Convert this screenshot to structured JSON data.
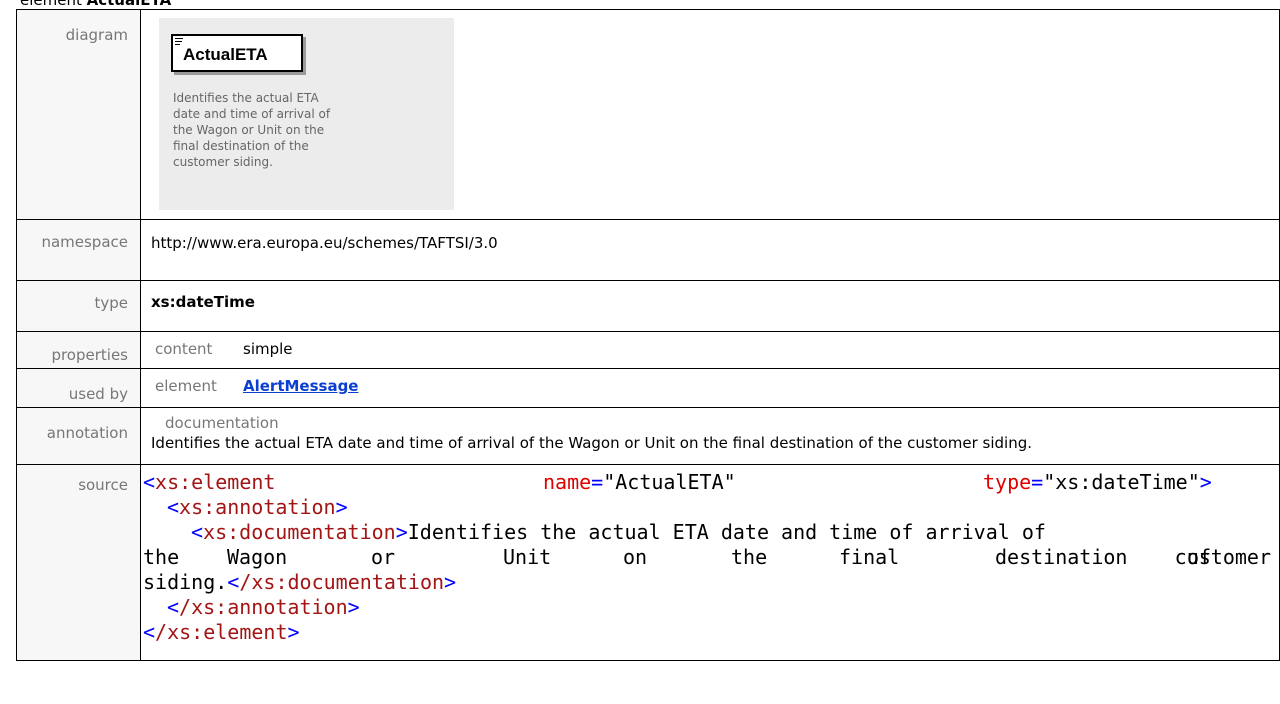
{
  "heading": {
    "prefix": "element",
    "name": "ActualETA"
  },
  "labels": {
    "diagram": "diagram",
    "namespace": "namespace",
    "type": "type",
    "properties": "properties",
    "used_by": "used by",
    "annotation": "annotation",
    "source": "source"
  },
  "diagram": {
    "element_name": "ActualETA",
    "description": "Identifies the actual ETA\ndate and time of arrival of\nthe Wagon or Unit on the\nfinal destination of the\ncustomer siding."
  },
  "namespace": "http://www.era.europa.eu/schemes/TAFTSI/3.0",
  "type": "xs:dateTime",
  "properties": {
    "key": "content",
    "value": "simple"
  },
  "used_by": {
    "key": "element",
    "link": "AlertMessage"
  },
  "annotation": {
    "key": "documentation",
    "text": "Identifies the actual ETA date and time of arrival of the Wagon or Unit on the final destination of the customer siding."
  },
  "source": {
    "open_tag": "xs:element",
    "name_attr": "name",
    "name_val": "\"ActualETA\"",
    "type_attr": "type",
    "type_val": "\"xs:dateTime\"",
    "annotation_tag": "xs:annotation",
    "documentation_tag": "xs:documentation",
    "doc_line1": "Identifies the actual ETA date and time of arrival of",
    "doc_line2_words": [
      "the",
      "Wagon",
      "or",
      "Unit",
      "on",
      "the",
      "final",
      "destination",
      "of",
      "the",
      "customer"
    ],
    "doc_line3": "siding.",
    "close_documentation": "/xs:documentation",
    "close_annotation": "/xs:annotation",
    "close_element": "/xs:element"
  }
}
